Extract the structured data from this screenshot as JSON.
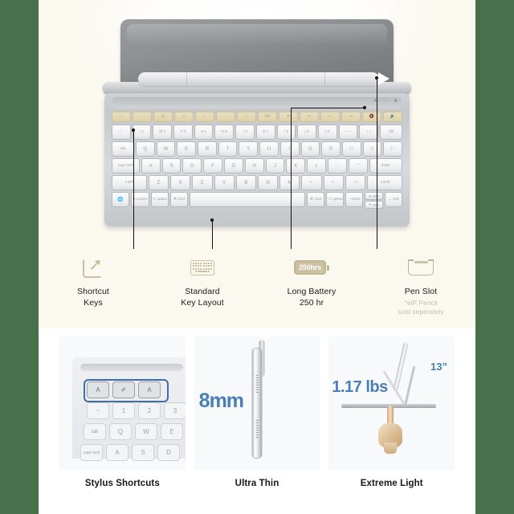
{
  "colors": {
    "frame_green": "#47704b",
    "hero_bg": "#fbf8f0",
    "accent_tan": "#c9bf9f",
    "accent_blue": "#4a7fb5",
    "card_bg": "#f8f9fa",
    "text_dark": "#1b1b1b",
    "text_muted": "#c4bfb1"
  },
  "hero": {
    "device": {
      "name": "tablet-keyboard-case",
      "indicator_icons": "A · ⌵ · ☀",
      "keyboard_rows": {
        "function_row": [
          "⌂",
          "☼",
          "▤",
          "◻",
          "◐",
          "☼",
          "▭",
          "⌨",
          "✱",
          "⏮",
          "⏯",
          "⏭",
          "🔇",
          "🔊"
        ],
        "number_row": [
          "~ `",
          "! 1",
          "@ 2",
          "# 3",
          "$ 4",
          "% 5",
          "^ 6",
          "& 7",
          "* 8",
          "( 9",
          ") 0",
          "— -",
          "+ =",
          "⌫"
        ],
        "qwerty_row": [
          "tab",
          "Q",
          "W",
          "E",
          "R",
          "T",
          "Y",
          "U",
          "I",
          "O",
          "P",
          "{ [",
          "} ]",
          "| \\"
        ],
        "home_row": [
          "caps lock",
          "A",
          "S",
          "D",
          "F",
          "G",
          "H",
          "J",
          "K",
          "L",
          ": ;",
          "\" '",
          "Enter"
        ],
        "shift_row": [
          "⇧shift",
          "Z",
          "X",
          "C",
          "V",
          "B",
          "N",
          "M",
          "< ,",
          "> .",
          "? /",
          "⇧shift"
        ],
        "bottom_row": [
          "🌐",
          "fn control",
          "⌥ option",
          "⌘ cmd",
          "",
          "⌘ cmd",
          "⌥ option",
          "↑ home",
          "▲ pgup",
          "▼ pgdn",
          "→ end"
        ]
      }
    },
    "features": [
      {
        "icon": "shortcut-arrow-icon",
        "label": "Shortcut\nKeys",
        "line1": "Shortcut",
        "line2": "Keys",
        "sub": ""
      },
      {
        "icon": "keyboard-icon",
        "label": "Standard Key Layout",
        "line1": "Standard",
        "line2": "Key Layout",
        "sub": ""
      },
      {
        "icon": "battery-icon",
        "icon_text": "250hrs",
        "label": "Long Battery 250 hr",
        "line1": "Long Battery",
        "line2": "250 hr",
        "sub": ""
      },
      {
        "icon": "pen-slot-icon",
        "label": "Pen Slot",
        "line1": "Pen Slot",
        "line2": "",
        "sub_line1": "*eiP Pencil",
        "sub_line2": "sold seperately"
      }
    ]
  },
  "cards": [
    {
      "caption": "Stylus Shortcuts",
      "image_name": "keyboard-closeup-highlighted-keys",
      "keys_top": [
        "A",
        "✐",
        "A"
      ]
    },
    {
      "caption": "Ultra Thin",
      "image_name": "device-edge-profile",
      "measurement": "8mm"
    },
    {
      "caption": "Extreme Light",
      "image_name": "hand-balancing-tablet",
      "weight": "1.17 lbs",
      "size": "13”"
    }
  ]
}
